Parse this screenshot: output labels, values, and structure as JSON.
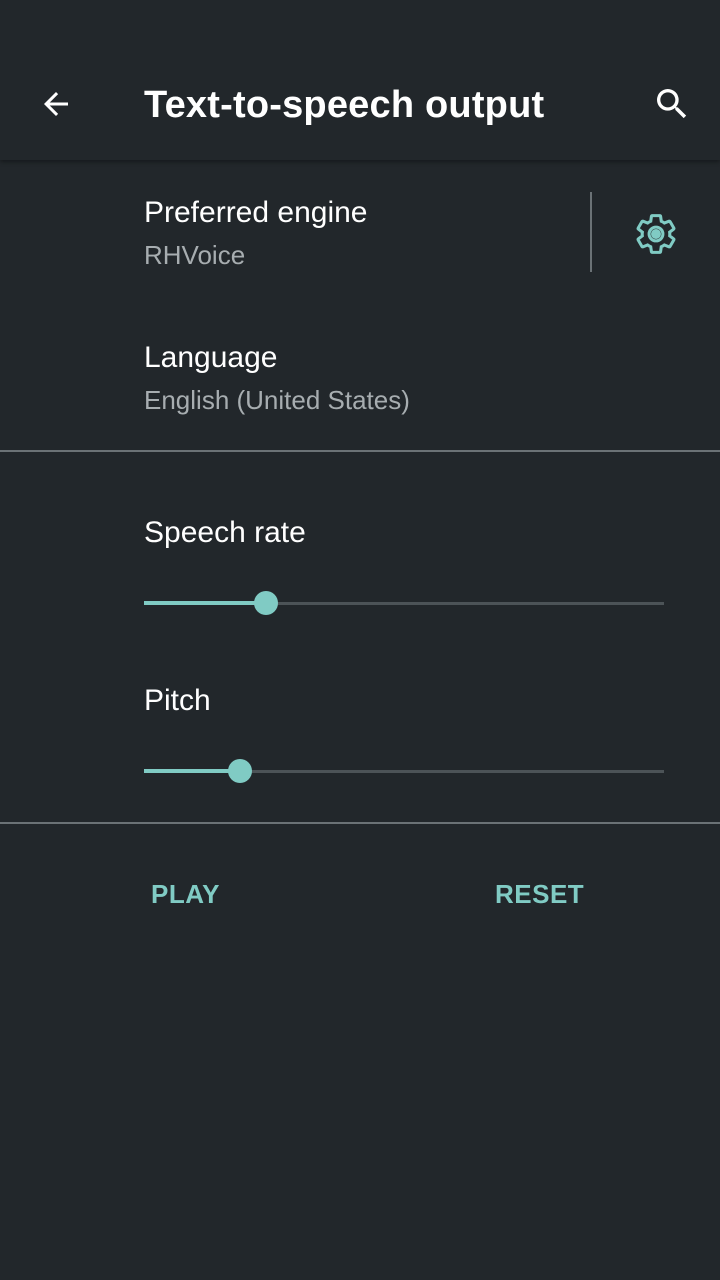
{
  "app_bar": {
    "title": "Text-to-speech output",
    "back_icon": "arrow-back-icon",
    "search_icon": "search-icon"
  },
  "preferred_engine": {
    "title": "Preferred engine",
    "summary": "RHVoice",
    "settings_icon": "gear-icon"
  },
  "language": {
    "title": "Language",
    "summary": "English (United States)"
  },
  "speech_rate": {
    "label": "Speech rate",
    "value_fraction": 0.235
  },
  "pitch": {
    "label": "Pitch",
    "value_fraction": 0.185
  },
  "buttons": {
    "play": "PLAY",
    "reset": "RESET"
  },
  "colors": {
    "background": "#22272b",
    "accent": "#80cbc4",
    "divider": "#6b7276",
    "secondary_text": "#a7adb0"
  }
}
